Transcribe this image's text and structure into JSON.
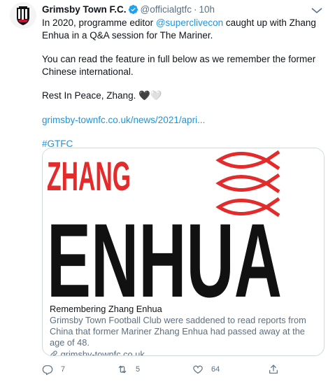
{
  "tweet": {
    "author_name": "Grimsby Town F.C.",
    "handle": "@officialgtfc",
    "separator": "·",
    "time": "10h",
    "body_line1_prefix": "In 2020, programme editor ",
    "mention": "@superclivecon",
    "body_line1_suffix": " caught up with Zhang Enhua in a Q&A session for The Mariner.",
    "body_para2": "You can read the feature in full below as we remember the former Chinese international.",
    "body_para3": "Rest In Peace, Zhang.",
    "body_para3_emoji": "🖤🤍",
    "link_text": "grimsby-townfc.co.uk/news/2021/apri...",
    "hashtag": "#GTFC"
  },
  "card": {
    "image_word1": "ZHANG",
    "image_word2": "ENHUA",
    "title": "Remembering Zhang Enhua",
    "description": "Grimsby Town Football Club were saddened to read reports from China that former Mariner Zhang Enhua had passed away at the age of 48.",
    "url": "grimsby-townfc.co.uk"
  },
  "actions": {
    "reply_count": "7",
    "retweet_count": "5",
    "like_count": "64"
  },
  "colors": {
    "link": "#1b95e0",
    "muted": "#5b7083",
    "image_red": "#e32b2b",
    "image_black": "#111111"
  }
}
